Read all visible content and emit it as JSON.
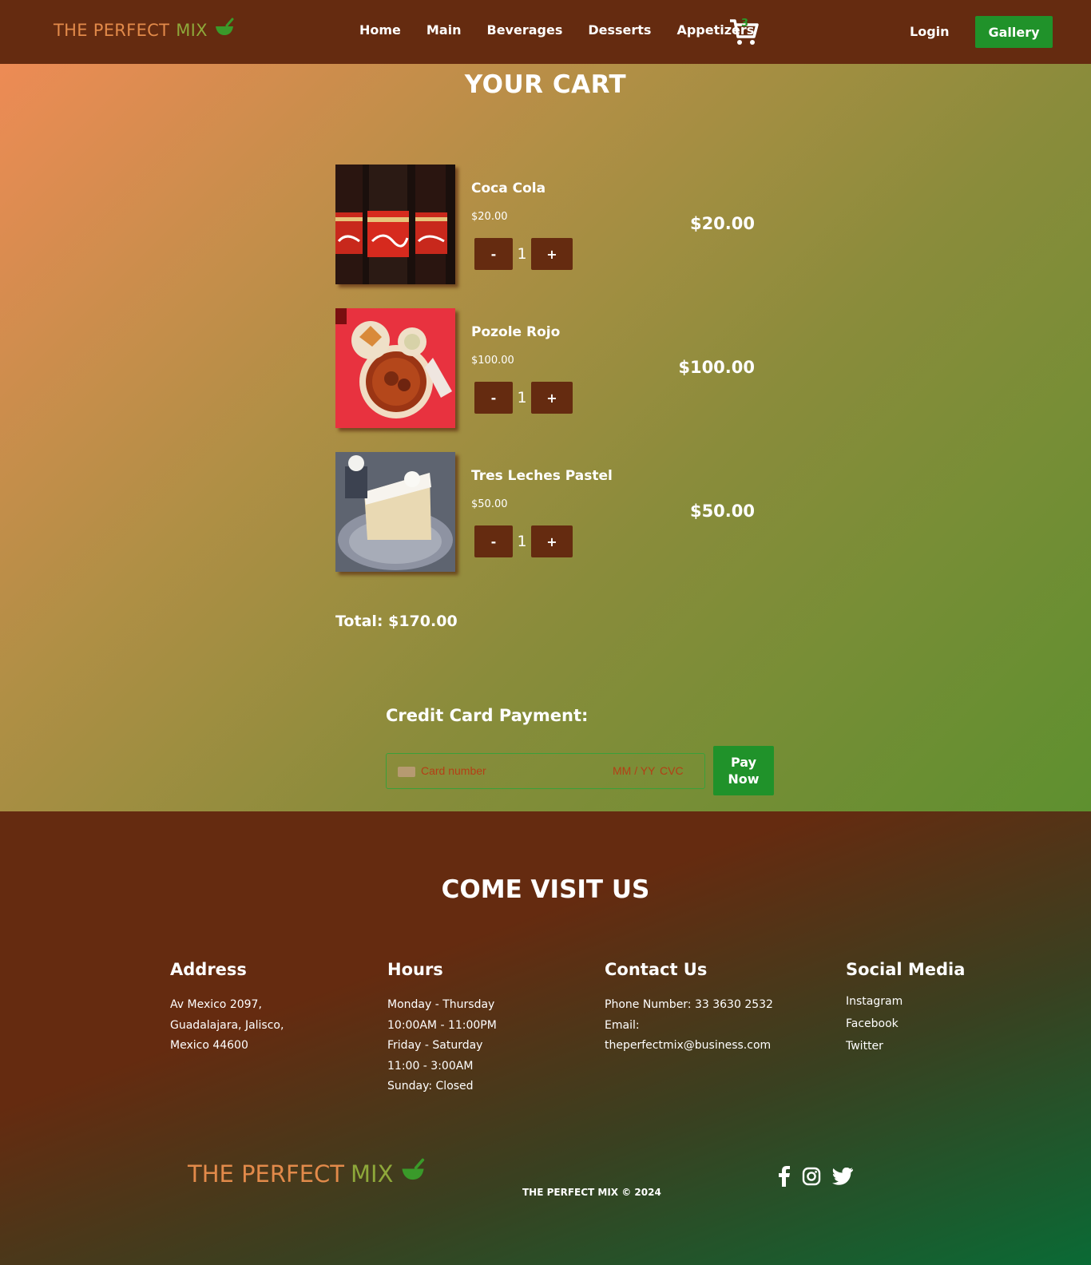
{
  "nav": {
    "brand_part1": "THE PERFECT",
    "brand_part2": "MIX",
    "links": [
      "Home",
      "Main",
      "Beverages",
      "Desserts",
      "Appetizers"
    ],
    "cart_count": "3",
    "login": "Login",
    "gallery": "Gallery"
  },
  "cart": {
    "title": "YOUR CART",
    "items": [
      {
        "name": "Coca Cola",
        "unit_price": "$20.00",
        "quantity": "1",
        "minus": "-",
        "plus": "+",
        "line_total": "$20.00"
      },
      {
        "name": "Pozole Rojo",
        "unit_price": "$100.00",
        "quantity": "1",
        "minus": "-",
        "plus": "+",
        "line_total": "$100.00"
      },
      {
        "name": "Tres Leches Pastel",
        "unit_price": "$50.00",
        "quantity": "1",
        "minus": "-",
        "plus": "+",
        "line_total": "$50.00"
      }
    ],
    "total": "Total: $170.00"
  },
  "payment": {
    "title": "Credit Card Payment:",
    "card_placeholder": "Card number",
    "expiry_placeholder": "MM / YY",
    "cvc_placeholder": "CVC",
    "pay_line1": "Pay",
    "pay_line2": "Now"
  },
  "footer": {
    "title": "COME VISIT US",
    "address": {
      "heading": "Address",
      "lines": [
        "Av Mexico 2097,",
        "Guadalajara, Jalisco,",
        "Mexico 44600"
      ]
    },
    "hours": {
      "heading": "Hours",
      "lines": [
        "Monday - Thursday",
        "10:00AM - 11:00PM",
        "Friday - Saturday",
        "11:00 - 3:00AM",
        "Sunday: Closed"
      ]
    },
    "contact": {
      "heading": "Contact Us",
      "lines": [
        "Phone Number: 33 3630 2532",
        "Email:",
        "theperfectmix@business.com"
      ]
    },
    "social": {
      "heading": "Social Media",
      "links": [
        "Instagram",
        "Facebook",
        "Twitter"
      ]
    },
    "brand_part1": "THE PERFECT",
    "brand_part2": "MIX",
    "copyright": "THE PERFECT MIX © 2024"
  },
  "colors": {
    "brown": "#652b10",
    "green": "#20922a",
    "orange": "#e28a4a",
    "olive": "#8ea83a"
  },
  "icons": [
    "bowl-icon",
    "cart-icon",
    "card-icon",
    "facebook-icon",
    "instagram-icon",
    "twitter-icon"
  ]
}
